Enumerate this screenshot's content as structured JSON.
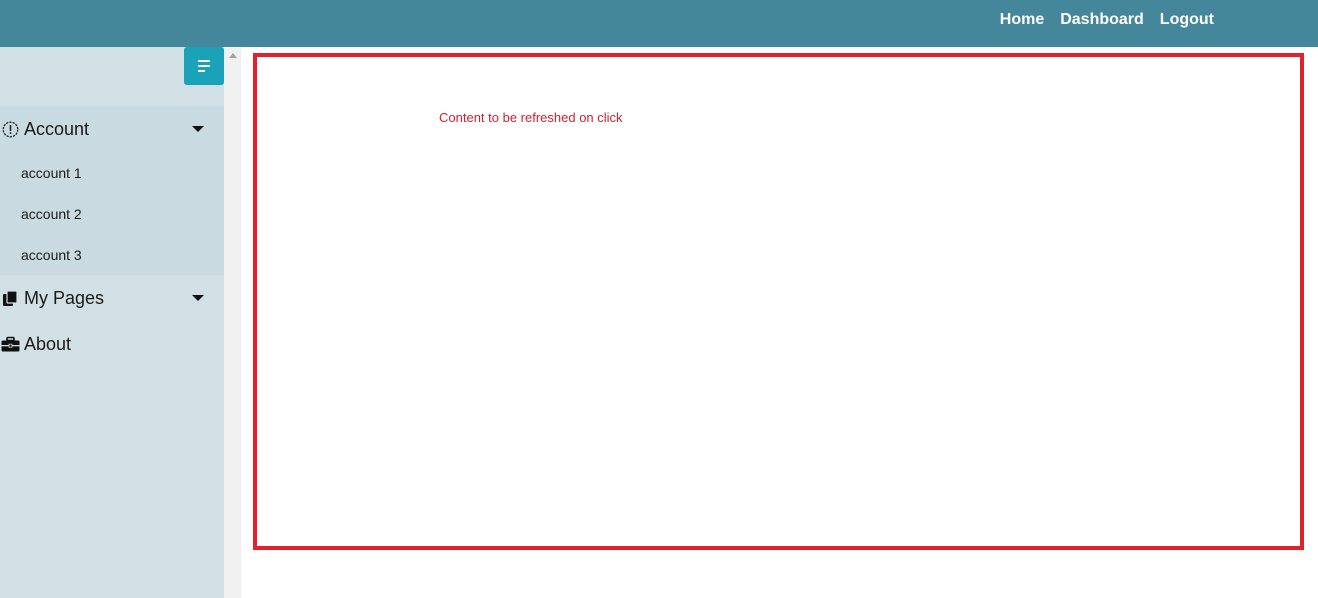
{
  "topnav": {
    "links": [
      "Home",
      "Dashboard",
      "Logout"
    ]
  },
  "sidebar": {
    "toggle_icon": "menu-align-left-icon",
    "items": [
      {
        "label": "Account",
        "icon": "info-circle-icon",
        "expanded": true,
        "subitems": [
          "account 1",
          "account 2",
          "account 3"
        ]
      },
      {
        "label": "My Pages",
        "icon": "copy-icon",
        "expanded": false
      },
      {
        "label": "About",
        "icon": "briefcase-icon"
      }
    ]
  },
  "content": {
    "text": "Content to be refreshed on click"
  },
  "colors": {
    "topbar": "#44869a",
    "sidebar": "#d1e0e5",
    "toggle_button": "#1aa3b8",
    "content_border": "#e3212d",
    "content_text": "#d4202c"
  }
}
